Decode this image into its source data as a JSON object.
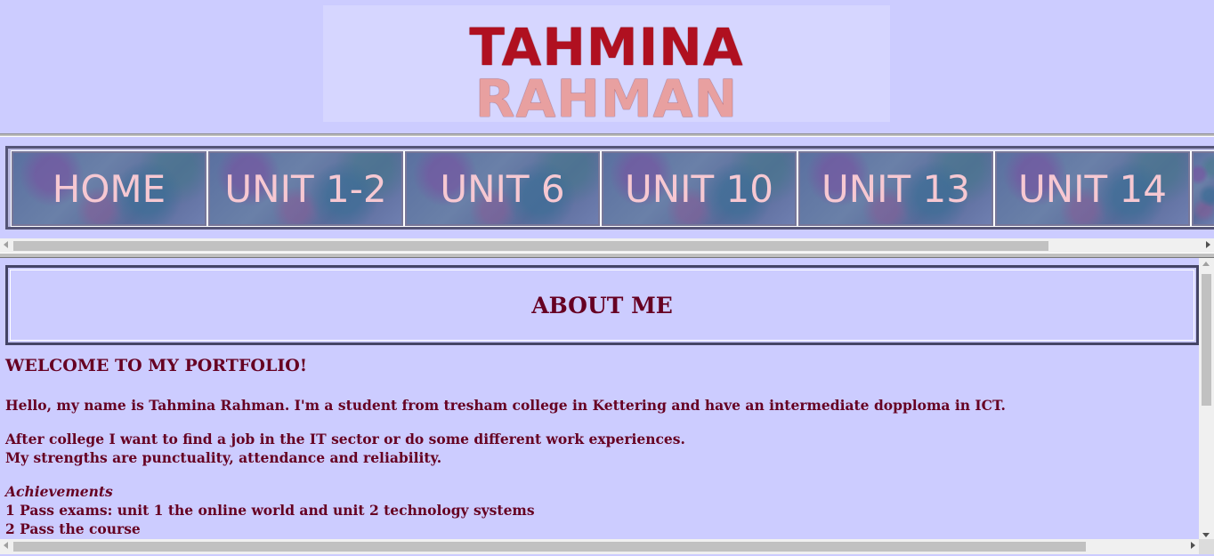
{
  "banner": {
    "first": "TAHMINA",
    "second": "RAHMAN"
  },
  "nav": {
    "items": [
      {
        "label": "HOME"
      },
      {
        "label": "UNIT 1-2"
      },
      {
        "label": "UNIT 6"
      },
      {
        "label": "UNIT 10"
      },
      {
        "label": "UNIT 13"
      },
      {
        "label": "UNIT 14"
      }
    ]
  },
  "about": {
    "title": "ABOUT ME"
  },
  "content": {
    "welcome": "WELCOME TO MY PORTFOLIO!",
    "intro": "Hello, my name is Tahmina Rahman. I'm a student from tresham college in Kettering and have an intermediate dopploma in ICT.",
    "goal_line1": "After college I want to find a job in the IT sector or do some different work experiences.",
    "goal_line2": "My strengths are punctuality, attendance and reliability.",
    "achievements_heading": "Achievements",
    "achievement_1": "1 Pass exams: unit 1 the online world and unit 2 technology systems",
    "achievement_2": "2 Pass the course"
  },
  "colors": {
    "background": "#ccccff",
    "text": "#660022",
    "nav_label": "#f6c8d2",
    "banner_red": "#b01020"
  }
}
